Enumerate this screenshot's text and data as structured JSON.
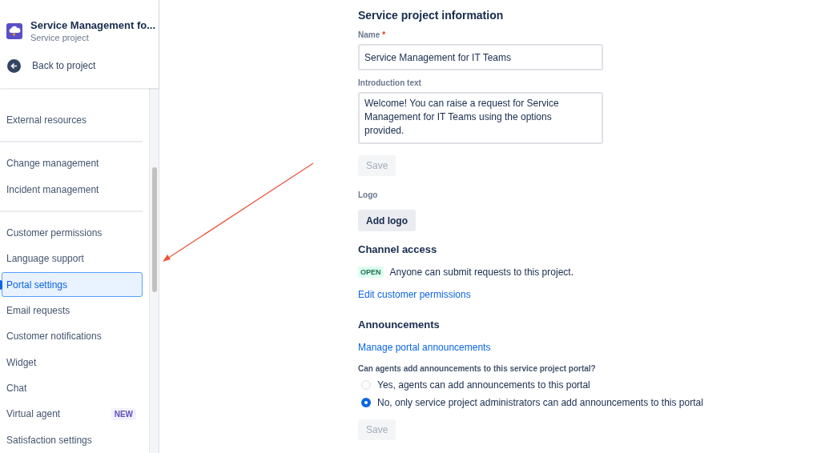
{
  "project": {
    "name": "Service Management fo...",
    "type": "Service project"
  },
  "back_link": "Back to project",
  "sidebar": {
    "groups": [
      [
        {
          "label": "External resources",
          "selected": false
        }
      ],
      [
        {
          "label": "Change management",
          "selected": false
        },
        {
          "label": "Incident management",
          "selected": false
        }
      ],
      [
        {
          "label": "Customer permissions",
          "selected": false
        },
        {
          "label": "Language support",
          "selected": false
        },
        {
          "label": "Portal settings",
          "selected": true
        },
        {
          "label": "Email requests",
          "selected": false
        },
        {
          "label": "Customer notifications",
          "selected": false
        },
        {
          "label": "Widget",
          "selected": false
        },
        {
          "label": "Chat",
          "selected": false
        },
        {
          "label": "Virtual agent",
          "selected": false,
          "badge": "NEW"
        },
        {
          "label": "Satisfaction settings",
          "selected": false
        }
      ]
    ]
  },
  "info": {
    "heading": "Service project information",
    "name_label": "Name",
    "required_mark": "*",
    "name_value": "Service Management for IT Teams",
    "intro_label": "Introduction text",
    "intro_value": "Welcome! You can raise a request for Service Management for IT Teams using the options provided.",
    "save": {
      "label": "Save",
      "disabled": true
    },
    "logo_label": "Logo",
    "add_logo": "Add logo"
  },
  "channel": {
    "heading": "Channel access",
    "status": "OPEN",
    "description": "Anyone can submit requests to this project.",
    "link": "Edit customer permissions"
  },
  "announcements": {
    "heading": "Announcements",
    "link": "Manage portal announcements",
    "question": "Can agents add announcements to this service project portal?",
    "options": [
      {
        "label": "Yes, agents can add announcements to this portal",
        "selected": false
      },
      {
        "label": "No, only service project administrators can add announcements to this portal",
        "selected": true
      }
    ],
    "save": {
      "label": "Save",
      "disabled": true
    }
  }
}
